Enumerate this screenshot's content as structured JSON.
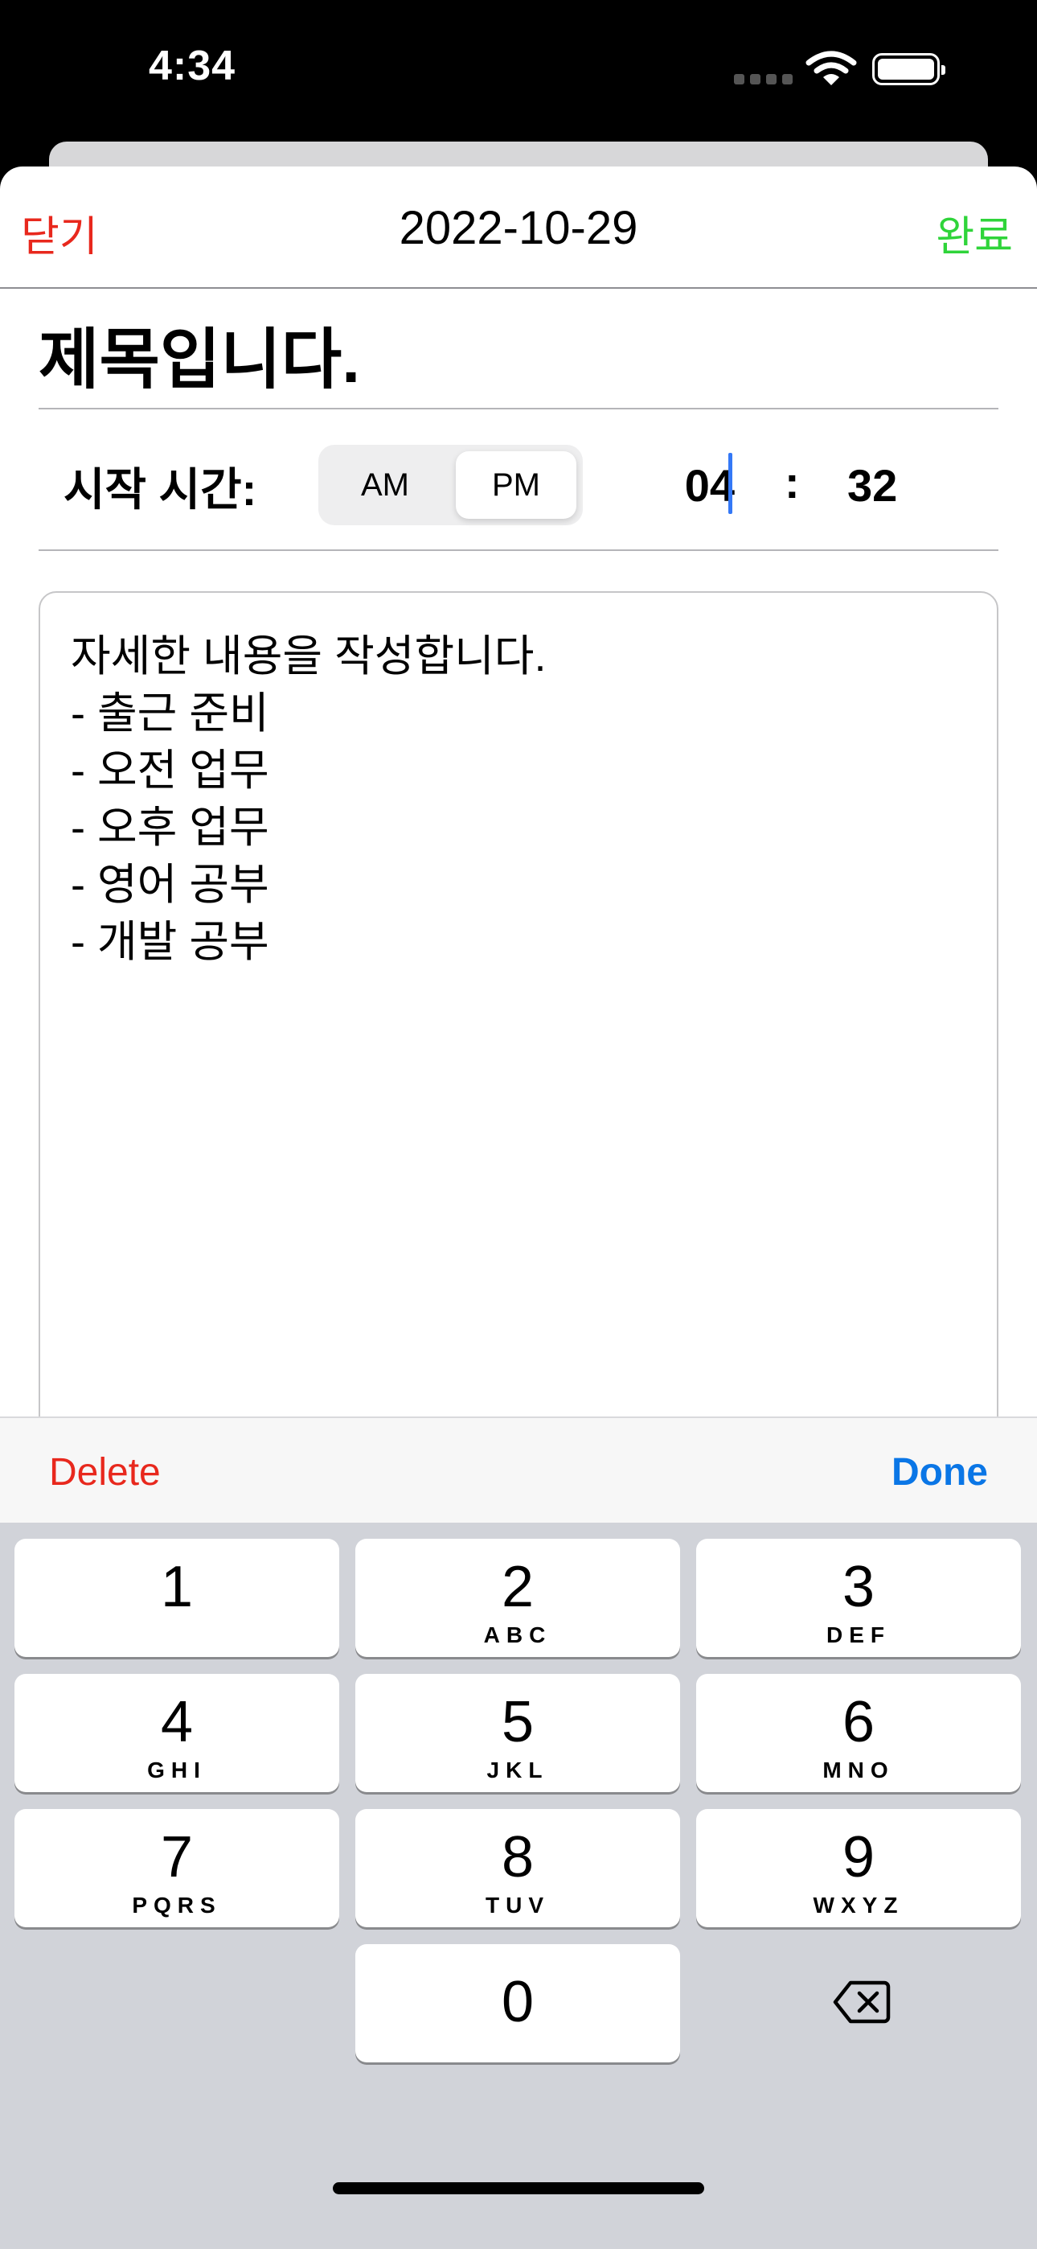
{
  "status_bar": {
    "time": "4:34",
    "icons": [
      "cellular-signal-icon",
      "wifi-icon",
      "battery-icon"
    ]
  },
  "nav": {
    "close_label": "닫기",
    "title": "2022-10-29",
    "done_label": "완료"
  },
  "form": {
    "title_value": "제목입니다.",
    "start_time_label": "시작 시간:",
    "meridiem_options": [
      "AM",
      "PM"
    ],
    "meridiem_selected": "PM",
    "hour": "04",
    "time_separator": ":",
    "minute": "32",
    "detail_text": "자세한 내용을 작성합니다.\n- 출근 준비\n- 오전 업무\n- 오후 업무\n- 영어 공부\n- 개발 공부"
  },
  "keyboard_toolbar": {
    "delete_label": "Delete",
    "done_label": "Done"
  },
  "keypad": {
    "keys": [
      {
        "digit": "1",
        "letters": ""
      },
      {
        "digit": "2",
        "letters": "ABC"
      },
      {
        "digit": "3",
        "letters": "DEF"
      },
      {
        "digit": "4",
        "letters": "GHI"
      },
      {
        "digit": "5",
        "letters": "JKL"
      },
      {
        "digit": "6",
        "letters": "MNO"
      },
      {
        "digit": "7",
        "letters": "PQRS"
      },
      {
        "digit": "8",
        "letters": "TUV"
      },
      {
        "digit": "9",
        "letters": "WXYZ"
      },
      {
        "digit": "0",
        "letters": ""
      }
    ],
    "backspace_icon": "backspace-icon"
  },
  "colors": {
    "close_red": "#e8281d",
    "done_green": "#2fd43a",
    "toolbar_done_blue": "#0a76e6",
    "caret_blue": "#3478f6",
    "keyboard_bg": "#d1d3d9"
  }
}
